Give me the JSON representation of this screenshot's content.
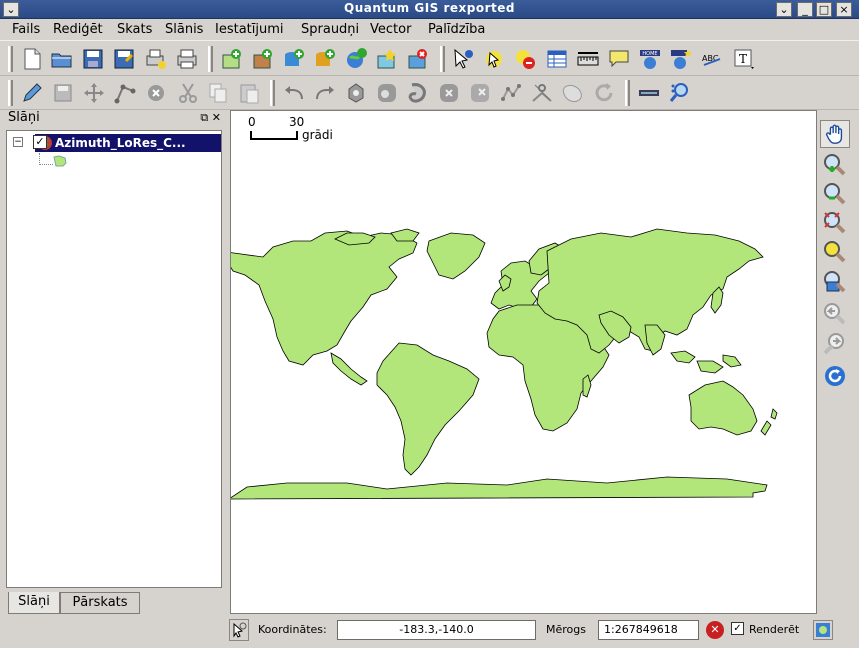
{
  "window": {
    "title": "Quantum GIS rexported"
  },
  "menu": [
    "Fails",
    "Rediģēt",
    "Skats",
    "Slānis",
    "Iestatījumi",
    "Spraudņi",
    "Vector",
    "Palīdzība"
  ],
  "toolbar1_icons": [
    "new-project-icon",
    "open-project-icon",
    "save-project-icon",
    "save-as-icon",
    "print-new-icon",
    "print-icon",
    "add-vector-icon",
    "add-raster-icon",
    "add-postgis-icon",
    "add-spatialite-icon",
    "add-wms-icon",
    "new-vector-icon",
    "remove-layer-icon",
    "identify-icon",
    "select-icon",
    "deselect-icon",
    "attribute-table-icon",
    "measure-line-icon",
    "map-tips-icon",
    "home-bookmark-icon",
    "new-bookmark-icon",
    "label-icon",
    "annotation-icon"
  ],
  "toolbar2_icons": [
    "toggle-edit-icon",
    "save-edits-icon",
    "move-feature-icon",
    "node-tool-icon",
    "delete-feature-icon",
    "cut-icon",
    "copy-icon",
    "paste-icon",
    "undo-icon",
    "redo-icon",
    "add-ring-icon",
    "add-island-icon",
    "simplify-icon",
    "delete-ring-icon",
    "delete-part-icon",
    "reshape-icon",
    "split-icon",
    "merge-icon",
    "rotate-icon",
    "gps-icon",
    "plugin-icon"
  ],
  "layers_panel": {
    "title": "Slāņi",
    "layer_name": "Azimuth_LoRes_C...",
    "tabs": [
      "Slāņi",
      "Pārskats"
    ]
  },
  "scalebar": {
    "tick0": "0",
    "tick1": "30",
    "unit": "grādi"
  },
  "right_tools": [
    "pan-icon",
    "zoom-in-icon",
    "zoom-out-icon",
    "zoom-full-icon",
    "zoom-layer-icon",
    "zoom-selection-icon",
    "zoom-last-icon",
    "zoom-next-icon",
    "refresh-icon"
  ],
  "status": {
    "coords_label": "Koordinātes:",
    "coords_value": "-183.3,-140.0",
    "scale_label": "Mērogs",
    "scale_value": "1:267849618",
    "render_label": "Renderēt",
    "render_checked": true
  },
  "colors": {
    "land": "#b2e57a",
    "selection": "#12126a",
    "title": "#2f508d"
  }
}
